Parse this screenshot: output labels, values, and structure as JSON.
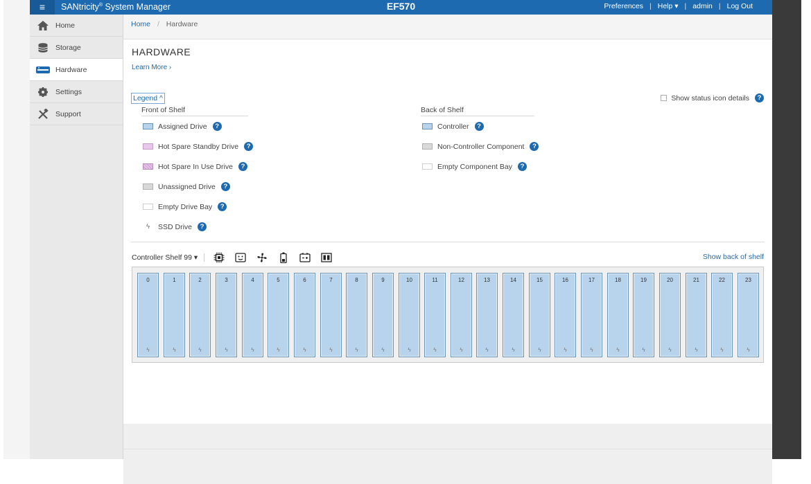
{
  "header": {
    "menu_icon": "hamburger-icon",
    "app_title": "SANtricity",
    "app_title_reg": "®",
    "app_title_rest": " System Manager",
    "system_name": "EF570",
    "links": {
      "preferences": "Preferences",
      "help": "Help ▾",
      "user": "admin",
      "logout": "Log Out"
    },
    "separator": "|"
  },
  "sidebar": {
    "items": [
      {
        "label": "Home",
        "icon": "home-icon"
      },
      {
        "label": "Storage",
        "icon": "storage-icon"
      },
      {
        "label": "Hardware",
        "icon": "hardware-icon",
        "active": true
      },
      {
        "label": "Settings",
        "icon": "gear-icon"
      },
      {
        "label": "Support",
        "icon": "tools-icon"
      }
    ]
  },
  "breadcrumb": {
    "home": "Home",
    "separator": "/",
    "current": "Hardware"
  },
  "page": {
    "title": "HARDWARE",
    "learn_more": "Learn More ›",
    "legend_toggle": "Legend ^",
    "show_status": "Show status icon details"
  },
  "legend": {
    "front_heading": "Front of Shelf",
    "back_heading": "Back of Shelf",
    "front_items": [
      "Assigned Drive",
      "Hot Spare Standby Drive",
      "Hot Spare In Use Drive",
      "Unassigned Drive",
      "Empty Drive Bay",
      "SSD Drive"
    ],
    "back_items": [
      "Controller",
      "Non-Controller Component",
      "Empty Component Bay"
    ],
    "help_glyph": "?",
    "bolt_glyph": "ϟ"
  },
  "shelf": {
    "selector": "Controller Shelf 99 ▾",
    "show_back": "Show back of shelf",
    "tools": [
      "chip-icon",
      "power-supply-icon",
      "fan-icon",
      "battery-icon",
      "temperature-icon",
      "controller-icon"
    ],
    "drives": [
      "0",
      "1",
      "2",
      "3",
      "4",
      "5",
      "6",
      "7",
      "8",
      "9",
      "10",
      "11",
      "12",
      "13",
      "14",
      "15",
      "16",
      "17",
      "18",
      "19",
      "20",
      "21",
      "22",
      "23"
    ],
    "drive_bolt": "ϟ"
  },
  "colors": {
    "brand": "#1e6ab0",
    "assigned": "#b8d4ec"
  }
}
